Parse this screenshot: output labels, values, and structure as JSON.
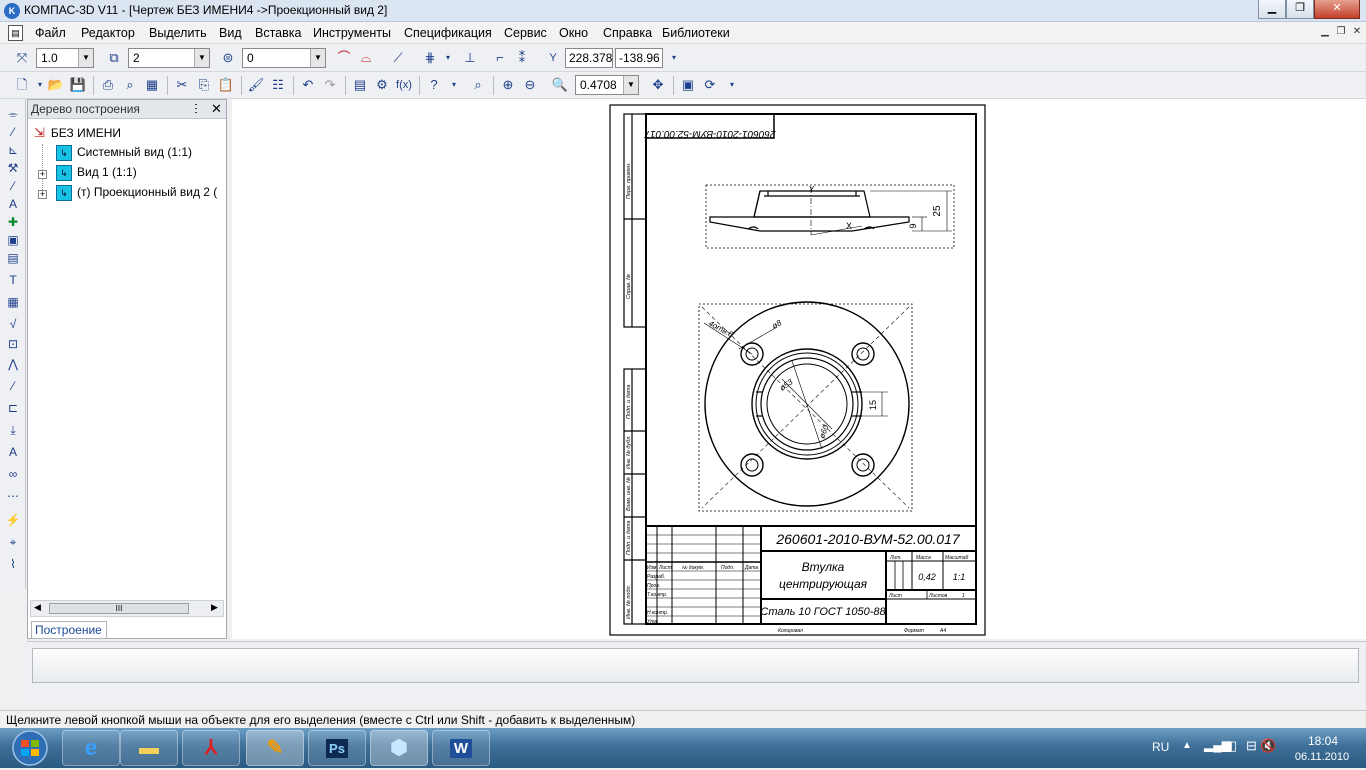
{
  "window": {
    "title": "КОМПАС-3D V11 - [Чертеж БЕЗ ИМЕНИ4 ->Проекционный вид 2]",
    "app_icon": "K"
  },
  "menu": {
    "items": [
      "Файл",
      "Редактор",
      "Выделить",
      "Вид",
      "Вставка",
      "Инструменты",
      "Спецификация",
      "Сервис",
      "Окно",
      "Справка",
      "Библиотеки"
    ]
  },
  "toolbar1": {
    "line_scale": "1.0",
    "layer": "2",
    "style": "0",
    "coord_x": "228.378",
    "coord_y": "-138.96"
  },
  "toolbar2": {
    "zoom": "0.4708"
  },
  "tree": {
    "title": "Дерево построения",
    "pin": "ⵗ",
    "close": "✕",
    "root": "БЕЗ ИМЕНИ",
    "nodes": [
      "Системный вид (1:1)",
      "Вид 1 (1:1)",
      "(т) Проекционный вид 2 ("
    ],
    "scroll_thumb": "III",
    "tab": "Построение"
  },
  "drawing": {
    "code_rotated": "260601-2010-ВУМ-52.00.017",
    "code": "260601-2010-ВУМ-52.00.017",
    "name_line1": "Втулка",
    "name_line2": "центрирующая",
    "material": "Сталь 10  ГОСТ 1050-88",
    "mass": "0,42",
    "scale": "1:1",
    "col_lit": "Лит.",
    "col_mass": "Масса",
    "col_scale": "Масштаб",
    "sheet": "Лист",
    "sheets": "Листов",
    "sheets_value": "1",
    "copied": "Копировал",
    "format": "Формат",
    "format_value": "A4",
    "row_izm": "Изм.",
    "row_list": "Лист",
    "row_doc": "№ докум.",
    "row_sign": "Подп.",
    "row_date": "Дата",
    "role_razrab": "Разраб.",
    "role_prov": "Пров.",
    "role_tkontr": "Т.контр.",
    "role_nkontr": "Н.контр.",
    "role_utv": "Утв.",
    "dim_25": "25",
    "dim_9": "9",
    "dim_15": "15",
    "dim_4x6": "4отв.6",
    "dim_d8": "ø8",
    "dim_d53": "ø53",
    "dim_d60": "ø60",
    "axis_x": "X",
    "axis_y": "Y",
    "side_1": "Перв. примен.",
    "side_2": "Справ. №",
    "side_3": "Подп. и дата",
    "side_4": "Инв. № дубл.",
    "side_5": "Взам. инв. №",
    "side_6": "Подп. и дата",
    "side_7": "Инв. № подл."
  },
  "status": {
    "hint": "Щелкните левой кнопкой мыши на объекте для его выделения (вместе с Ctrl или Shift - добавить к выделенным)"
  },
  "taskbar": {
    "apps": [
      "ie-icon",
      "explorer-icon",
      "acrobat-icon",
      "kompas-icon",
      "photoshop-icon",
      "kompas3d-icon",
      "word-icon"
    ],
    "lang": "RU",
    "time": "18:04",
    "date": "06.11.2010"
  },
  "colors": {
    "selected_view": "#000000",
    "tree_icon": "#19c3e6",
    "taskbar": "#3e6f98"
  }
}
